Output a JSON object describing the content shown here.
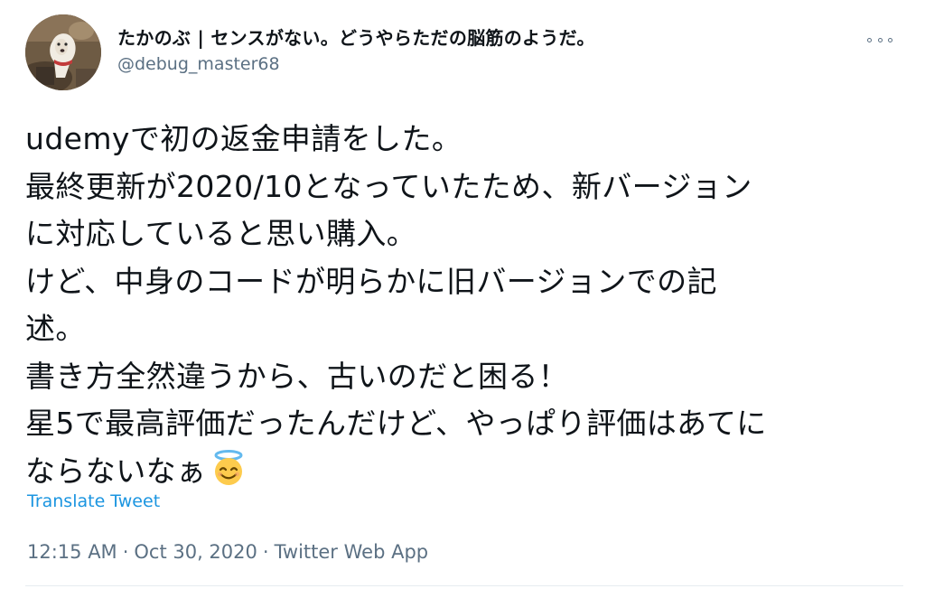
{
  "user": {
    "display_name": "たかのぶ | センスがない。どうやらただの脳筋のようだ。",
    "handle": "@debug_master68"
  },
  "menu": {
    "icon": "more-horizontal-icon"
  },
  "tweet": {
    "lines": [
      "udemyで初の返金申請をした。",
      "最終更新が2020/10となっていたため、新バージョン",
      "に対応していると思い購入。",
      "けど、中身のコードが明らかに旧バージョンでの記",
      "述。",
      "書き方全然違うから、古いのだと困る！",
      "星5で最高評価だったんだけど、やっぱり評価はあてに",
      "ならないなぁ"
    ],
    "emoji": "smiling-face-with-halo-icon",
    "translate_label": "Translate Tweet",
    "time": "12:15 AM",
    "separator": "·",
    "date": "Oct 30, 2020",
    "source": "Twitter Web App"
  },
  "colors": {
    "text": "#0f1419",
    "secondary": "#5b7083",
    "link": "#1b95e0"
  }
}
